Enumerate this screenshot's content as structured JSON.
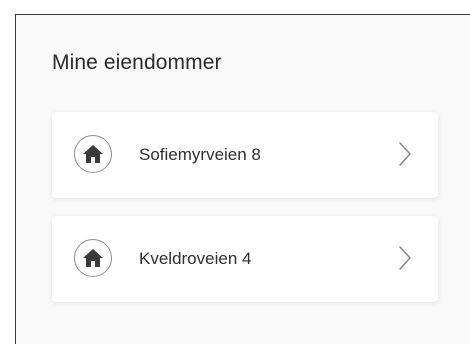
{
  "section": {
    "title": "Mine eiendommer"
  },
  "properties": [
    {
      "label": "Sofiemyrveien 8",
      "icon": "home-icon",
      "action_icon": "chevron-right-icon"
    },
    {
      "label": "Kveldroveien 4",
      "icon": "home-icon",
      "action_icon": "chevron-right-icon"
    }
  ],
  "colors": {
    "background": "#f9f9f9",
    "card": "#ffffff",
    "text": "#2f2f2f",
    "icon": "#3a3a3a",
    "chevron": "#8a8a8a"
  }
}
